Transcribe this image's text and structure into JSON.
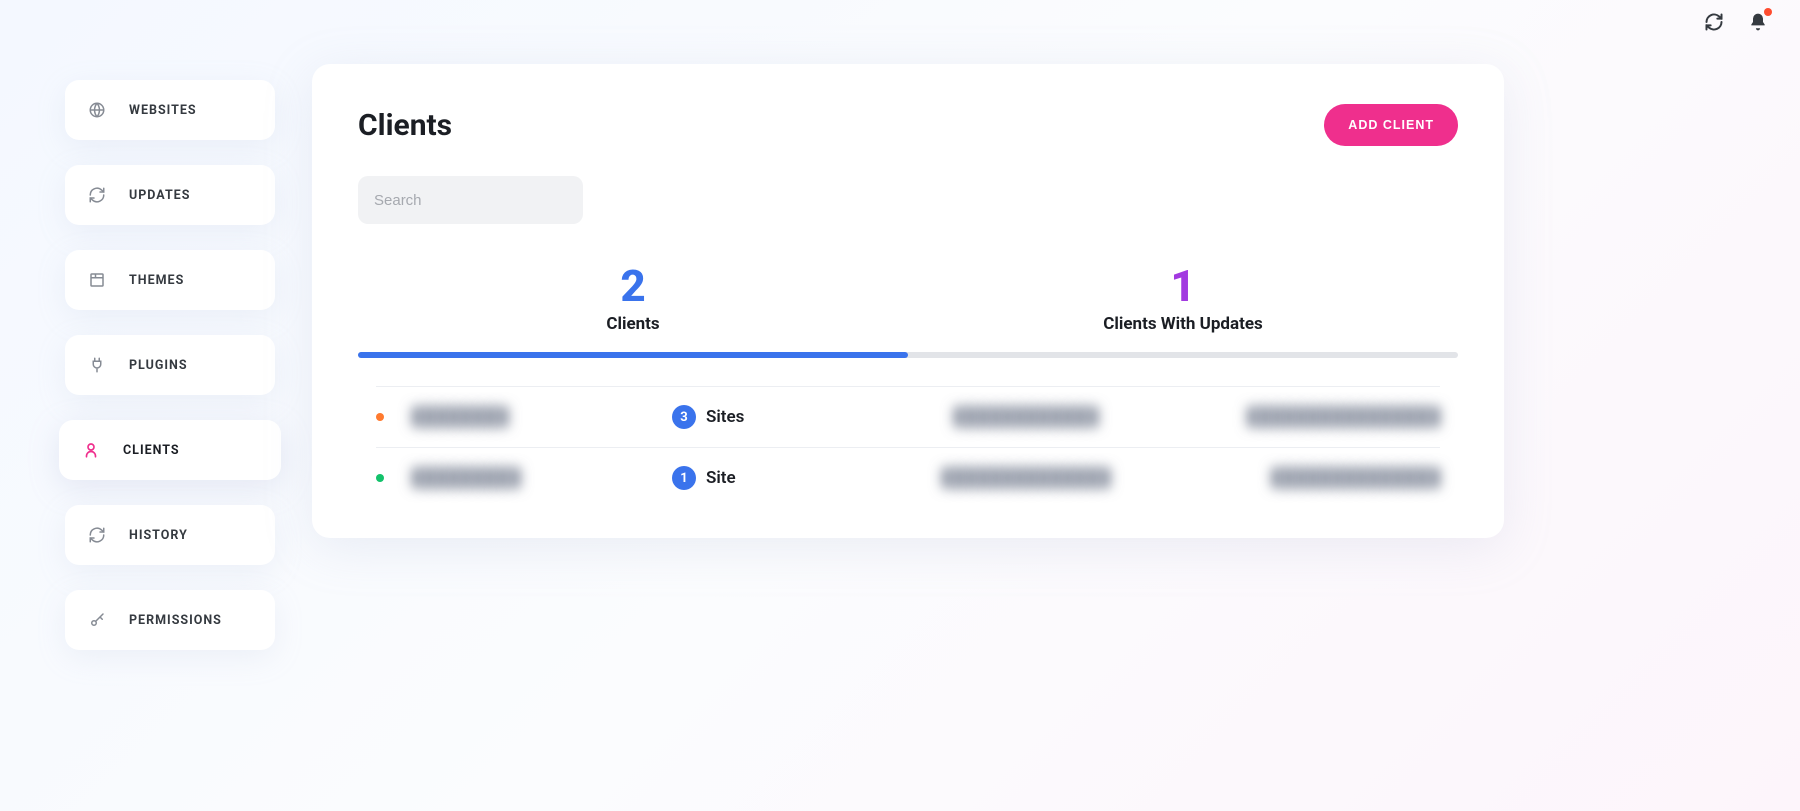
{
  "topbar": {
    "refresh_icon": "refresh",
    "bell_icon": "bell"
  },
  "sidebar": {
    "items": [
      {
        "name": "websites",
        "label": "WEBSITES",
        "icon": "globe"
      },
      {
        "name": "updates",
        "label": "UPDATES",
        "icon": "refresh"
      },
      {
        "name": "themes",
        "label": "THEMES",
        "icon": "window"
      },
      {
        "name": "plugins",
        "label": "PLUGINS",
        "icon": "plug"
      },
      {
        "name": "clients",
        "label": "CLIENTS",
        "icon": "user",
        "active": true
      },
      {
        "name": "history",
        "label": "HISTORY",
        "icon": "refresh"
      },
      {
        "name": "permissions",
        "label": "PERMISSIONS",
        "icon": "key"
      }
    ]
  },
  "main": {
    "title": "Clients",
    "add_button": "ADD CLIENT",
    "search_placeholder": "Search",
    "stats": [
      {
        "value": "2",
        "label": "Clients",
        "color": "blue",
        "active": true
      },
      {
        "value": "1",
        "label": "Clients With Updates",
        "color": "purple"
      }
    ],
    "rows": [
      {
        "status": "orange",
        "name": "████████",
        "count": "3",
        "sites_word": "Sites",
        "company": "████████████",
        "email": "████████████████"
      },
      {
        "status": "green",
        "name": "█████████",
        "count": "1",
        "sites_word": "Site",
        "company": "██████████████",
        "email": "██████████████"
      }
    ]
  }
}
